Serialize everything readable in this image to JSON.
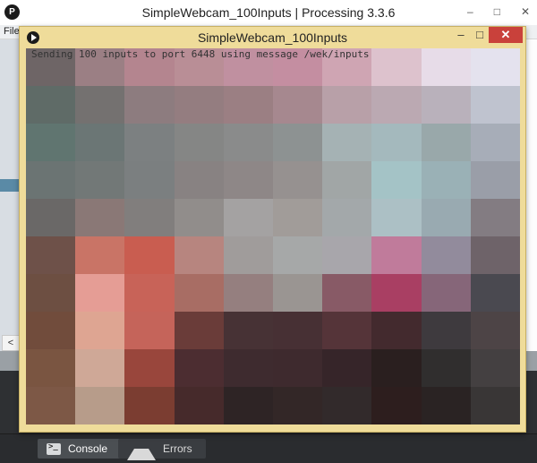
{
  "ide": {
    "title": "SimpleWebcam_100Inputs | Processing 3.3.6",
    "logo": "P",
    "menu_file": "File",
    "controls": [
      "–",
      "□",
      "✕"
    ],
    "scroll_left_icon": "<",
    "tabs": {
      "console": {
        "label": "Console",
        "icon": "console-icon"
      },
      "errors": {
        "label": "Errors",
        "icon": "warning-icon"
      }
    }
  },
  "sketch": {
    "title": "SimpleWebcam_100Inputs",
    "status_text": "Sending 100 inputs to port 6448 using message /wek/inputs",
    "controls": {
      "minimize": "–",
      "maximize": "□",
      "close": "✕"
    },
    "grid_colors": [
      [
        "#6e6566",
        "#9b7f84",
        "#b4858f",
        "#b98e96",
        "#c090a0",
        "#c48ea1",
        "#cfa5b3",
        "#ddc2cd",
        "#e7dce8",
        "#e4e2ee"
      ],
      [
        "#5f6b67",
        "#747170",
        "#8d7c7f",
        "#947d80",
        "#9b7f83",
        "#a6888f",
        "#b8a0a8",
        "#bba9b2",
        "#b9b1bb",
        "#bfc3cf"
      ],
      [
        "#607570",
        "#6b7675",
        "#7c8081",
        "#858685",
        "#8a8b8b",
        "#8d9292",
        "#a5b2b4",
        "#a4b9bd",
        "#99a8aa",
        "#a7adb8"
      ],
      [
        "#6b7473",
        "#727877",
        "#7b7f80",
        "#888282",
        "#8e8787",
        "#969190",
        "#a1a6a6",
        "#a4c3c6",
        "#9ab1b6",
        "#9a9ea8"
      ],
      [
        "#6a6867",
        "#8a7876",
        "#817e7d",
        "#918d8b",
        "#a4a2a2",
        "#a19c99",
        "#a3a8aa",
        "#acc0c5",
        "#99aab1",
        "#837c82"
      ],
      [
        "#6e5149",
        "#c97466",
        "#c95d50",
        "#b7857f",
        "#a09c9b",
        "#a6a8a8",
        "#a8a6ab",
        "#c07b9b",
        "#928b9c",
        "#6e6369"
      ],
      [
        "#6d4f42",
        "#e59d95",
        "#c86358",
        "#a86d64",
        "#957f7f",
        "#9a9592",
        "#885a66",
        "#a93f63",
        "#866679",
        "#4a4950"
      ],
      [
        "#714c3c",
        "#dea592",
        "#c5645a",
        "#6a3c39",
        "#473235",
        "#473034",
        "#553439",
        "#432a2e",
        "#3e3a3e",
        "#4d4446"
      ],
      [
        "#7a5541",
        "#cfa897",
        "#99463c",
        "#4c2d31",
        "#3e2b2f",
        "#3e2a2e",
        "#362529",
        "#2a1f1f",
        "#302e2e",
        "#444041"
      ],
      [
        "#7d5846",
        "#b79c8a",
        "#7b3d31",
        "#462a2b",
        "#2e2425",
        "#332727",
        "#322a2b",
        "#2d1e1e",
        "#2a2323",
        "#393636"
      ]
    ]
  }
}
